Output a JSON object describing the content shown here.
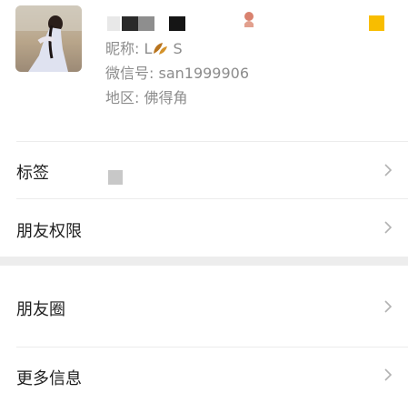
{
  "profile": {
    "nickname_label": "昵称: L",
    "nickname_tail": "S",
    "wechat_id": "微信号: san1999906",
    "region": "地区: 佛得角"
  },
  "rows": [
    {
      "label": "标签"
    },
    {
      "label": "朋友权限"
    },
    {
      "label": "朋友圈"
    },
    {
      "label": "更多信息"
    }
  ],
  "colors": {
    "accent_yellow": "#f8bd00",
    "separator_band": "#ededed"
  },
  "icons": {
    "chevron": "chevron-right-icon",
    "leaf": "leaf-emoji-icon",
    "location": "location-pin-icon"
  }
}
